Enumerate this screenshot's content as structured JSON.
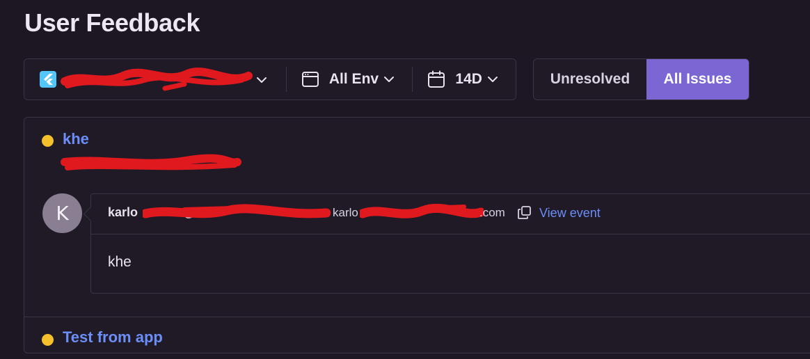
{
  "page": {
    "title": "User Feedback"
  },
  "filters": {
    "project_icon": "flutter-icon",
    "env_icon": "browser-window-icon",
    "env_label": "All Env",
    "period_icon": "calendar-icon",
    "period_label": "14D"
  },
  "status_toggle": {
    "options": [
      "Unresolved",
      "All Issues"
    ],
    "selected": "All Issues"
  },
  "feedback": [
    {
      "title": "khe",
      "status_color": "#f5c02b",
      "author_avatar_initial": "K",
      "author_name_prefix": "karlo",
      "author_name_at": "@",
      "author_email_prefix": "karlo",
      "author_email_suffix": ".com",
      "view_event_label": "View event",
      "message": "khe"
    },
    {
      "title": "Test from app",
      "status_color": "#f5c02b"
    }
  ],
  "colors": {
    "accent": "#7b66d4",
    "link": "#6c8ef7",
    "background": "#1c1722",
    "unresolved_dot": "#f5c02b"
  }
}
